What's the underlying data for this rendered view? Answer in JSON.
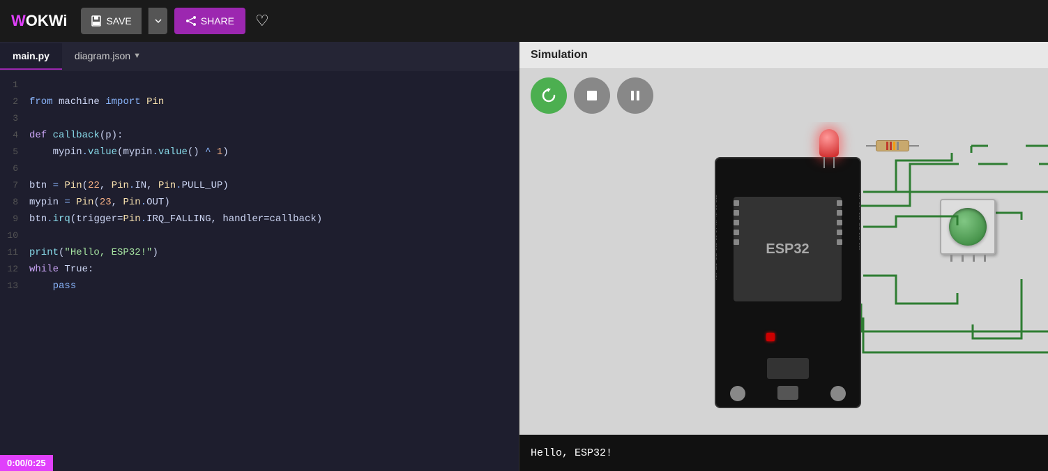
{
  "header": {
    "logo": "WOKWi",
    "save_label": "SAVE",
    "share_label": "SHARE"
  },
  "tabs": {
    "active": "main.py",
    "items": [
      {
        "id": "main-py",
        "label": "main.py"
      },
      {
        "id": "diagram-json",
        "label": "diagram.json"
      }
    ]
  },
  "code": {
    "lines": [
      {
        "num": 1,
        "content": ""
      },
      {
        "num": 2,
        "content": "from machine import Pin"
      },
      {
        "num": 3,
        "content": ""
      },
      {
        "num": 4,
        "content": "def callback(p):"
      },
      {
        "num": 5,
        "content": "    mypin.value(mypin.value() ^ 1)"
      },
      {
        "num": 6,
        "content": ""
      },
      {
        "num": 7,
        "content": "btn = Pin(22, Pin.IN, Pin.PULL_UP)"
      },
      {
        "num": 8,
        "content": "mypin = Pin(23, Pin.OUT)"
      },
      {
        "num": 9,
        "content": "btn.irq(trigger=Pin.IRQ_FALLING, handler=callback)"
      },
      {
        "num": 10,
        "content": ""
      },
      {
        "num": 11,
        "content": "print(\"Hello, ESP32!\")"
      },
      {
        "num": 12,
        "content": "while True:"
      },
      {
        "num": 13,
        "content": "    pass"
      }
    ]
  },
  "simulation": {
    "title": "Simulation",
    "restart_label": "↺",
    "stop_label": "■",
    "pause_label": "⏸",
    "esp32_label": "ESP32",
    "serial_output": "Hello, ESP32!",
    "timer": "0:00/0:25"
  }
}
